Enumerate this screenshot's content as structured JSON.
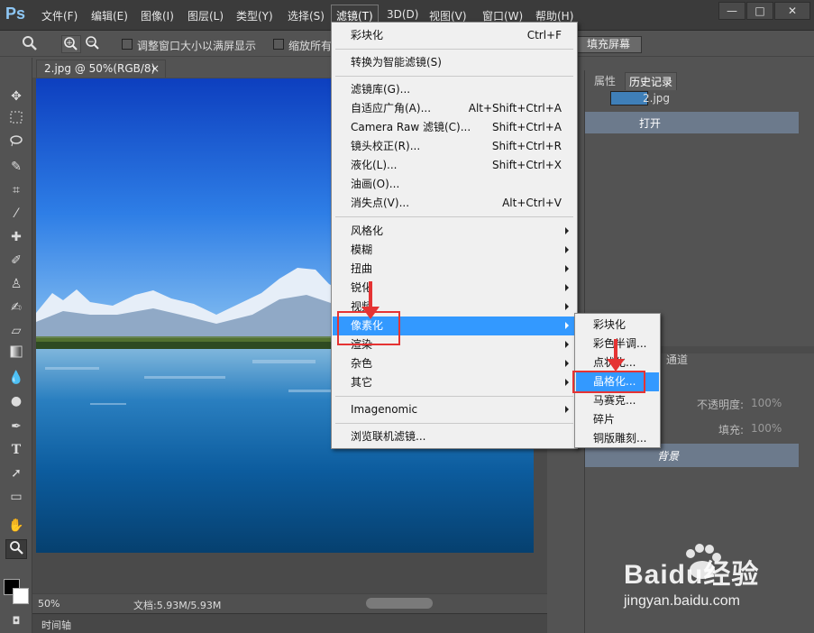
{
  "app": {
    "logo": "Ps"
  },
  "menubar": {
    "items": [
      "文件(F)",
      "编辑(E)",
      "图像(I)",
      "图层(L)",
      "类型(Y)",
      "选择(S)",
      "滤镜(T)",
      "3D(D)",
      "视图(V)",
      "窗口(W)",
      "帮助(H)"
    ],
    "window_controls": {
      "minimize": "—",
      "restore": "□",
      "close": "✕"
    }
  },
  "options_bar": {
    "zoom_in": "+",
    "zoom_out": "−",
    "resize_windows_label": "调整窗口大小以满屏显示",
    "zoom_all_label": "缩放所有",
    "fill_screen_label": "填充屏幕"
  },
  "document": {
    "tab_title": "2.jpg @ 50%(RGB/8)",
    "close": "×"
  },
  "status_bar": {
    "zoom": "50%",
    "doc_info": "文档:5.93M/5.93M"
  },
  "timeline": {
    "label": "时间轴"
  },
  "filter_menu": {
    "items": [
      {
        "label": "彩块化",
        "shortcut": "Ctrl+F"
      },
      {
        "label": "转换为智能滤镜(S)",
        "shortcut": ""
      },
      {
        "label": "滤镜库(G)...",
        "shortcut": ""
      },
      {
        "label": "自适应广角(A)...",
        "shortcut": "Alt+Shift+Ctrl+A"
      },
      {
        "label": "Camera Raw 滤镜(C)...",
        "shortcut": "Shift+Ctrl+A"
      },
      {
        "label": "镜头校正(R)...",
        "shortcut": "Shift+Ctrl+R"
      },
      {
        "label": "液化(L)...",
        "shortcut": "Shift+Ctrl+X"
      },
      {
        "label": "油画(O)...",
        "shortcut": ""
      },
      {
        "label": "消失点(V)...",
        "shortcut": "Alt+Ctrl+V"
      },
      {
        "label": "风格化",
        "shortcut": ""
      },
      {
        "label": "模糊",
        "shortcut": ""
      },
      {
        "label": "扭曲",
        "shortcut": ""
      },
      {
        "label": "锐化",
        "shortcut": ""
      },
      {
        "label": "视频",
        "shortcut": ""
      },
      {
        "label": "像素化",
        "shortcut": ""
      },
      {
        "label": "渲染",
        "shortcut": ""
      },
      {
        "label": "杂色",
        "shortcut": ""
      },
      {
        "label": "其它",
        "shortcut": ""
      },
      {
        "label": "Imagenomic",
        "shortcut": ""
      },
      {
        "label": "浏览联机滤镜...",
        "shortcut": ""
      }
    ]
  },
  "pixelate_submenu": {
    "items": [
      "彩块化",
      "彩色半调...",
      "点状化...",
      "晶格化...",
      "马赛克...",
      "碎片",
      "铜版雕刻..."
    ]
  },
  "history_panel": {
    "tabs": [
      "属性",
      "历史记录"
    ],
    "snapshot": "2.jpg",
    "steps": [
      "打开"
    ]
  },
  "layers_panel": {
    "tab_partial": "通道",
    "opacity_label": "不透明度:",
    "opacity_value": "100%",
    "fill_label": "填充:",
    "fill_value": "100%",
    "layer_name": "背景"
  },
  "watermark": {
    "brand": "Baidu经验",
    "url": "jingyan.baidu.com"
  }
}
